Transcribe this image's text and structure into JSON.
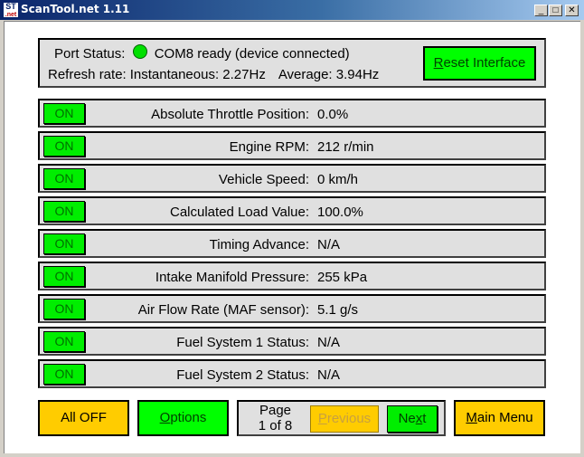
{
  "window": {
    "title": "ScanTool.net 1.11",
    "icon": "scantool-logo-icon",
    "controls": {
      "minimize": "_",
      "maximize": "□",
      "close": "✕"
    }
  },
  "status": {
    "port_label": "Port Status:",
    "port_indicator_color": "#00e000",
    "port_text": "COM8 ready (device connected)",
    "refresh_label": "Refresh rate:",
    "instantaneous": "Instantaneous: 2.27Hz",
    "average": "Average: 3.94Hz",
    "reset_button": {
      "accel": "R",
      "rest": "eset Interface"
    }
  },
  "sensors": [
    {
      "toggle": "ON",
      "label": "Absolute Throttle Position:",
      "value": "0.0%"
    },
    {
      "toggle": "ON",
      "label": "Engine RPM:",
      "value": "212 r/min"
    },
    {
      "toggle": "ON",
      "label": "Vehicle Speed:",
      "value": "0 km/h"
    },
    {
      "toggle": "ON",
      "label": "Calculated Load Value:",
      "value": "100.0%"
    },
    {
      "toggle": "ON",
      "label": "Timing Advance:",
      "value": "N/A"
    },
    {
      "toggle": "ON",
      "label": "Intake Manifold Pressure:",
      "value": "255 kPa"
    },
    {
      "toggle": "ON",
      "label": "Air Flow Rate (MAF sensor):",
      "value": "5.1 g/s"
    },
    {
      "toggle": "ON",
      "label": "Fuel System 1 Status:",
      "value": "N/A"
    },
    {
      "toggle": "ON",
      "label": "Fuel System 2 Status:",
      "value": "N/A"
    }
  ],
  "footer": {
    "all_off": "All OFF",
    "options": {
      "accel": "O",
      "rest": "ptions"
    },
    "page_line1": "Page",
    "page_line2": "1 of 8",
    "previous": {
      "accel": "P",
      "rest": "revious"
    },
    "next": {
      "pre": "Ne",
      "accel": "x",
      "rest": "t"
    },
    "main_menu": {
      "accel": "M",
      "rest": "ain Menu"
    }
  },
  "colors": {
    "on_green": "#00ee00",
    "button_green": "#00ff00",
    "button_orange": "#ffcc00",
    "panel_gray": "#e0e0e0"
  }
}
